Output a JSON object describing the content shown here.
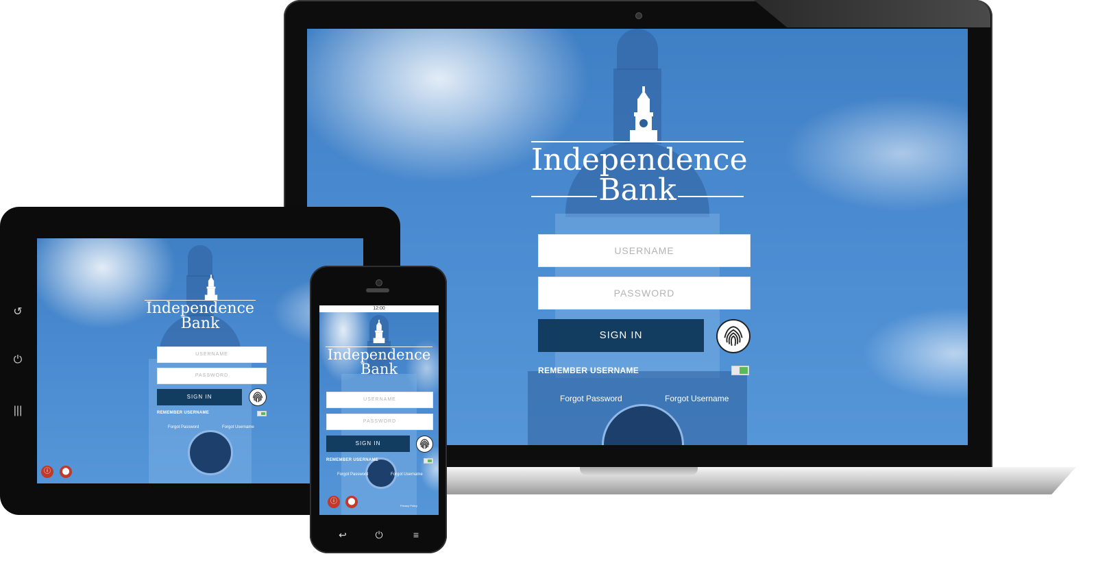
{
  "brand": {
    "line1": "Independence",
    "line2": "Bank"
  },
  "login": {
    "username_placeholder": "USERNAME",
    "password_placeholder": "PASSWORD",
    "sign_in_label": "SIGN IN",
    "remember_label": "REMEMBER USERNAME",
    "forgot_password": "Forgot Password",
    "forgot_username": "Forgot Username"
  },
  "phone": {
    "status_time": "12:00",
    "footer_link": "Privacy Policy"
  },
  "icons": {
    "fingerprint": "fingerprint-icon",
    "info": "info-icon",
    "location": "location-pin-icon",
    "back": "back-icon",
    "home": "home-icon",
    "menu": "menu-icon"
  },
  "colors": {
    "sky": "#4a8ad0",
    "sign_in_bg": "#123c60",
    "toggle_on": "#5cb85c",
    "round_button": "#c0392b"
  }
}
